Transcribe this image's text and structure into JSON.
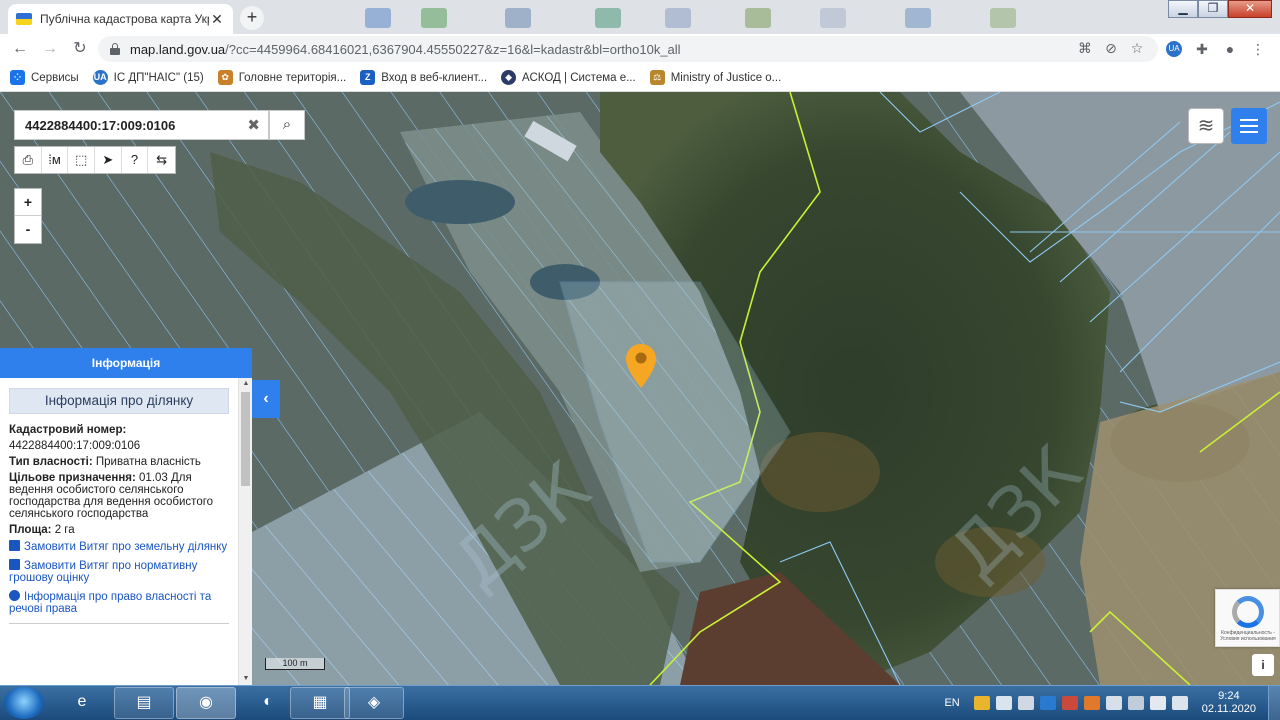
{
  "browser": {
    "tab_title": "Публічна кадастрова карта Укр",
    "close_symbol": "✕",
    "new_tab_symbol": "+",
    "url_host": "map.land.gov.ua",
    "url_rest": "/?cc=4459964.68416021,6367904.45550227&z=16&l=kadastr&bl=ortho10k_all",
    "window_controls": [
      "▁",
      "❐",
      "✕"
    ]
  },
  "bookmarks": [
    {
      "label": "Сервисы",
      "icon": "apps-icon",
      "color": "#1a73e8"
    },
    {
      "label": "ІС ДП\"НАІС\" (15)",
      "icon": "nais-icon",
      "color": "#2d72c9"
    },
    {
      "label": "Головне територія...",
      "icon": "emblem-icon",
      "color": "#c9802a"
    },
    {
      "label": "Вход в веб-клиент...",
      "icon": "z-icon",
      "color": "#1b5fc2"
    },
    {
      "label": "АСКОД | Система е...",
      "icon": "askod-icon",
      "color": "#2b3a66"
    },
    {
      "label": "Ministry of Justice o...",
      "icon": "scales-icon",
      "color": "#b8862b"
    }
  ],
  "map": {
    "search_value": "4422884400:17:009:0106",
    "search_clear": "✖",
    "search_icon": "🔍",
    "tools": [
      "print-icon",
      "measure-line-icon",
      "measure-area-icon",
      "select-icon",
      "identify-icon",
      "settings-icon"
    ],
    "tool_glyphs": [
      "⎙",
      "⁞м",
      "⬚",
      "➤",
      "?",
      "⇆"
    ],
    "zoom_in": "+",
    "zoom_out": "-",
    "layers_glyph": "≋",
    "scale_label": "100 m",
    "recaptcha_text": "Конфиденциальность - Условия использования",
    "info_glyph": "i",
    "watermark": "ДЗК",
    "colors": {
      "parcel_line": "#8ec9f4",
      "boundary": "#c9f036",
      "pin": "#f5a623",
      "accent": "#2f80ed"
    }
  },
  "panel": {
    "header": "Інформація",
    "subheader": "Інформація про ділянку",
    "cadastral_label": "Кадастровий номер:",
    "cadastral_value": "4422884400:17:009:0106",
    "ownership_label": "Тип власності:",
    "ownership_value": "Приватна власність",
    "purpose_label": "Цільове призначення:",
    "purpose_value": "01.03 Для ведення особистого селянського господарства для ведення особистого селянського господарства",
    "area_label": "Площа:",
    "area_value": "2 га",
    "links": [
      {
        "label": "Замовити Витяг про земельну ділянку",
        "icon": "document-icon"
      },
      {
        "label": "Замовити Витяг про нормативну грошову оцінку",
        "icon": "document-icon"
      },
      {
        "label": "Інформація про право власності та речові права",
        "icon": "info-icon"
      }
    ],
    "collapse_glyph": "‹"
  },
  "taskbar": {
    "items": [
      "ie-icon",
      "explorer-icon",
      "chrome-icon",
      "edge-icon",
      "clipboard-icon",
      "askod-app-icon"
    ],
    "lang": "EN",
    "time": "9:24",
    "date": "02.11.2020"
  }
}
